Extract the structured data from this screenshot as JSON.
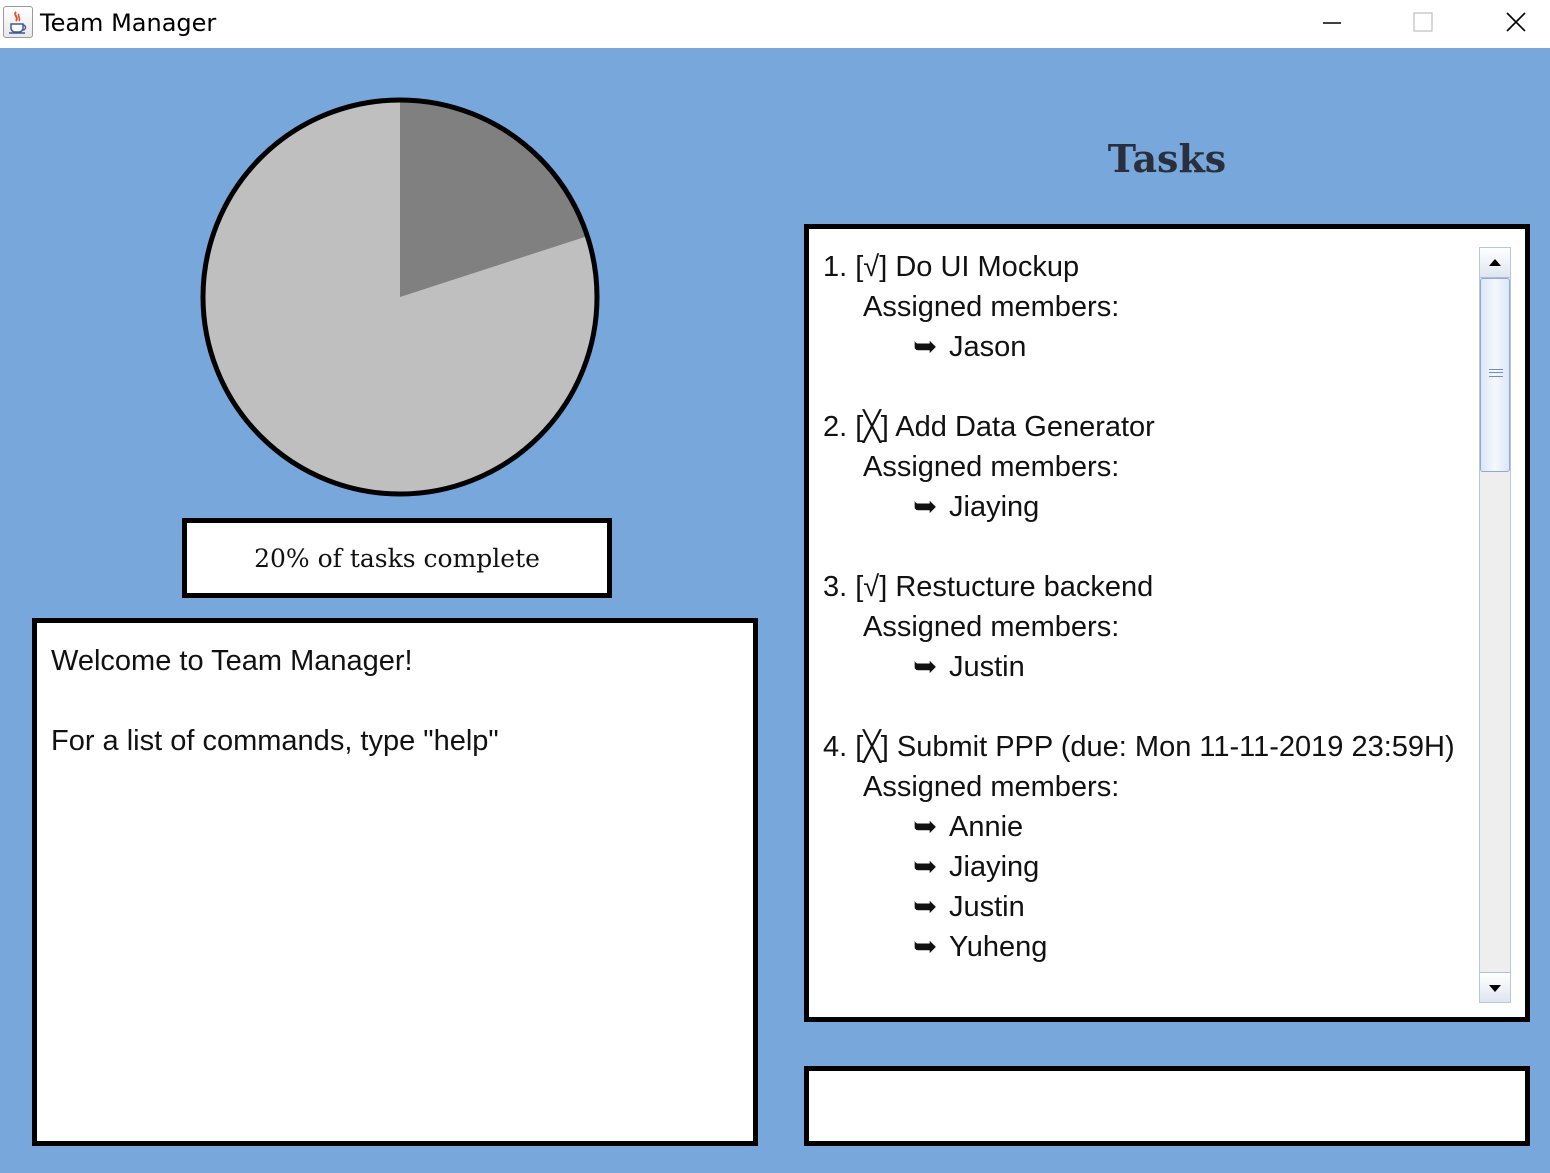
{
  "window": {
    "title": "Team Manager",
    "icon": "java-cup-icon",
    "controls": [
      "minimize-icon",
      "maximize-icon",
      "close-icon"
    ]
  },
  "progress": {
    "label": "20% of tasks complete",
    "complete_fraction": 0.2,
    "colors": {
      "complete": "#808080",
      "remaining": "#bfbfbf",
      "outline": "#000000"
    }
  },
  "console": {
    "lines": [
      "Welcome to Team Manager!",
      "",
      "For a list of commands, type \"help\""
    ]
  },
  "tasks": {
    "title": "Tasks",
    "assigned_label": "Assigned members:",
    "member_arrow": "➥",
    "items": [
      {
        "number": "1.",
        "status": "[√]",
        "name": "Do UI Mockup",
        "members": [
          "Jason"
        ]
      },
      {
        "number": "2.",
        "status": "[╳]",
        "name": "Add Data Generator",
        "members": [
          "Jiaying"
        ]
      },
      {
        "number": "3.",
        "status": "[√]",
        "name": "Restucture backend",
        "members": [
          "Justin"
        ]
      },
      {
        "number": "4.",
        "status": "[╳]",
        "name": "Submit PPP (due: Mon 11-11-2019 23:59H)",
        "members": [
          "Annie",
          "Jiaying",
          "Justin",
          "Yuheng"
        ]
      }
    ]
  },
  "command": {
    "value": "",
    "placeholder": ""
  },
  "theme": {
    "background": "#77a7db",
    "panel": "#ffffff",
    "border": "#000000"
  }
}
